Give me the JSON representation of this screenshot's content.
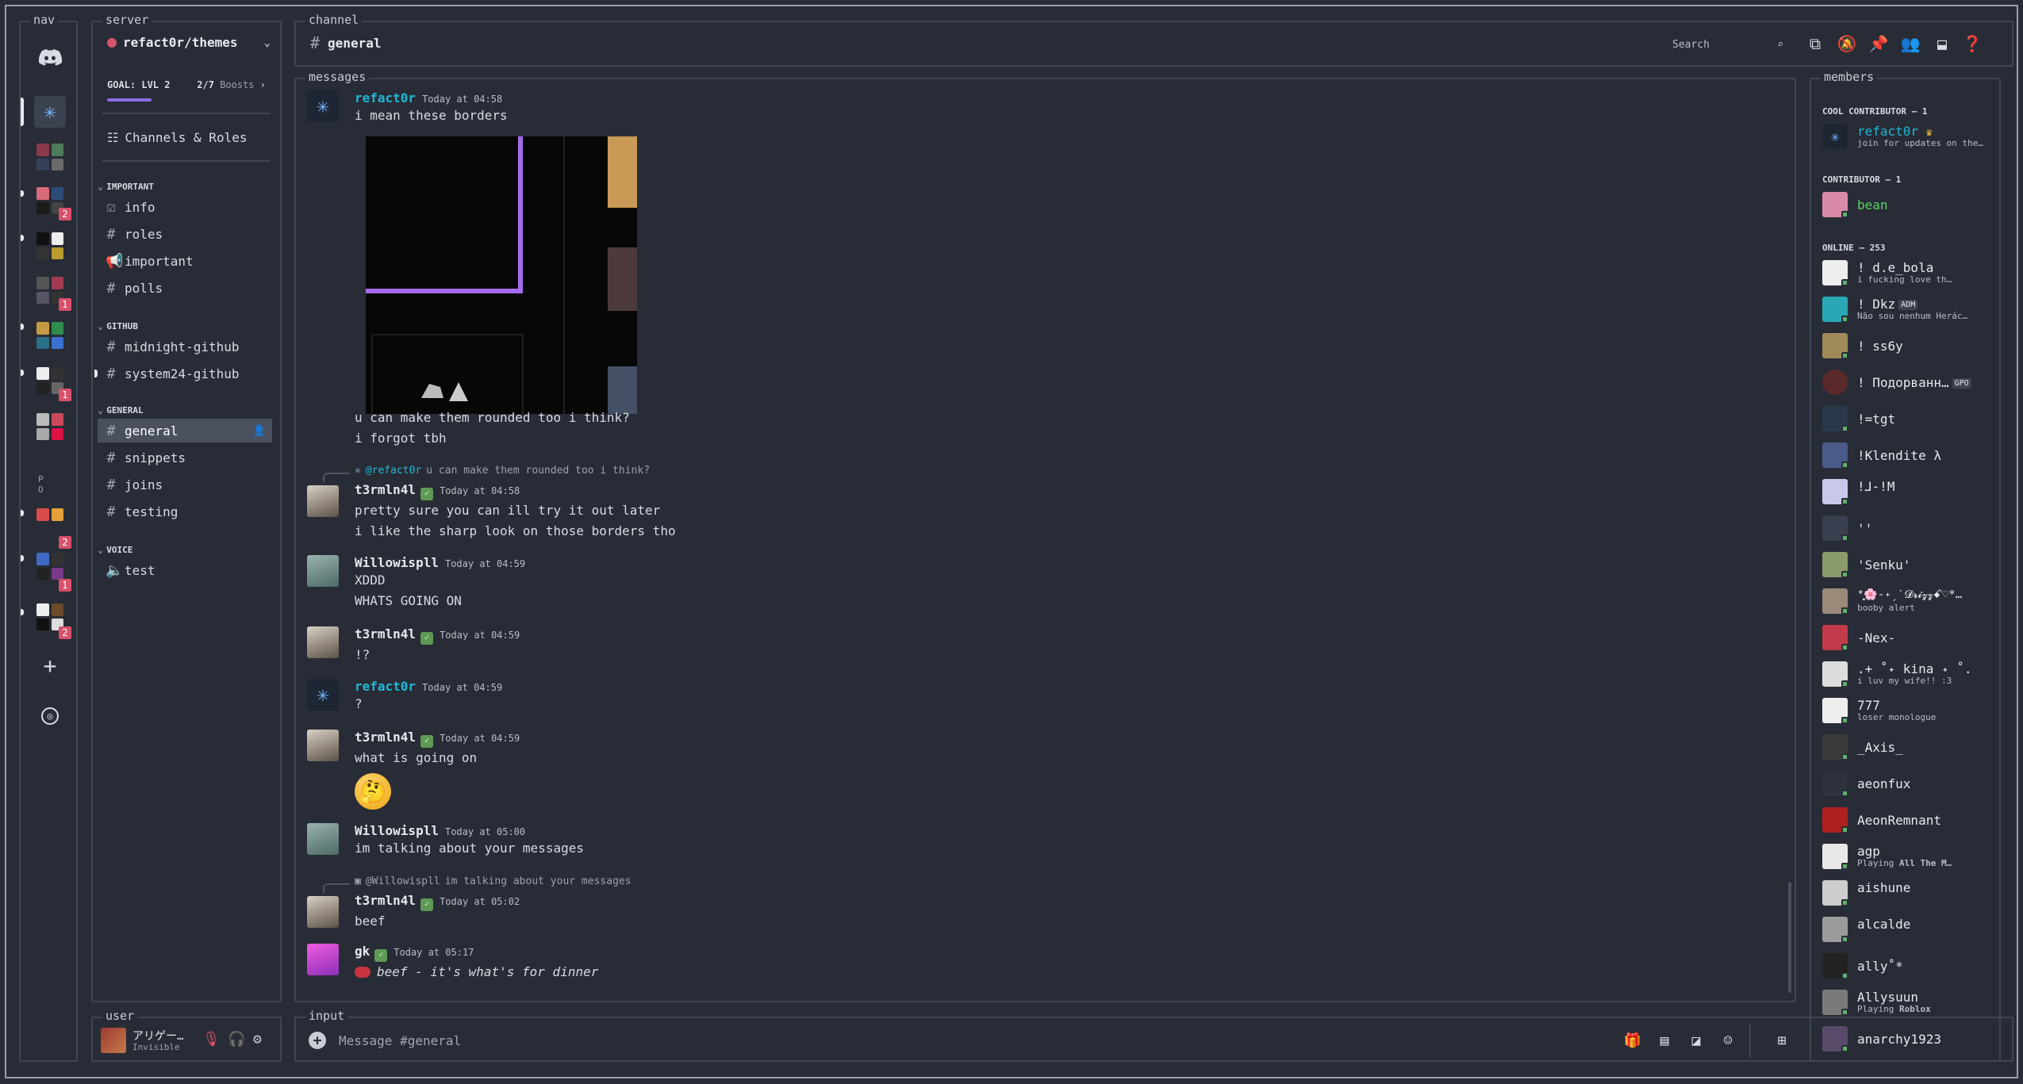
{
  "frames": {
    "nav": "nav",
    "server": "server",
    "channel": "channel",
    "messages": "messages",
    "members": "members",
    "user": "user",
    "input": "input"
  },
  "nav": {
    "badges": [
      "2",
      "1",
      "1",
      "2",
      "1",
      "2"
    ],
    "po_text": "P O"
  },
  "server": {
    "name": "refact0r/themes",
    "goal": "GOAL: LVL 2",
    "boosts_count": "2/7",
    "boosts_label": "Boosts",
    "channels_roles": "Channels & Roles",
    "categories": {
      "important": "IMPORTANT",
      "github": "GITHUB",
      "general": "GENERAL",
      "voice": "VOICE"
    },
    "channels": {
      "info": "info",
      "roles": "roles",
      "important": "important",
      "polls": "polls",
      "midnight_github": "midnight-github",
      "system24_github": "system24-github",
      "general": "general",
      "snippets": "snippets",
      "joins": "joins",
      "testing": "testing",
      "test": "test"
    }
  },
  "user": {
    "name": "アリゲー…",
    "status": "Invisible"
  },
  "channel": {
    "name": "general",
    "search_placeholder": "Search"
  },
  "messages": [
    {
      "author": "refact0r",
      "time": "Today at 04:58",
      "lines": [
        "i mean these borders"
      ]
    },
    {
      "lines": [
        "u can make them rounded too i think?",
        "i forgot tbh"
      ]
    },
    {
      "reply_to": "@refact0r",
      "reply_text": "u can make them rounded too i think?",
      "author": "t3rmln4l",
      "time": "Today at 04:58",
      "lines": [
        "pretty sure you can ill try it out later",
        "i like the sharp look on those borders tho"
      ]
    },
    {
      "author": "Willowispll",
      "time": "Today at 04:59",
      "lines": [
        "XDDD",
        "WHATS GOING ON"
      ]
    },
    {
      "author": "t3rmln4l",
      "time": "Today at 04:59",
      "lines": [
        "!?"
      ]
    },
    {
      "author": "refact0r",
      "time": "Today at 04:59",
      "lines": [
        "?"
      ]
    },
    {
      "author": "t3rmln4l",
      "time": "Today at 04:59",
      "lines": [
        "what is going on"
      ]
    },
    {
      "author": "Willowispll",
      "time": "Today at 05:00",
      "lines": [
        "im talking about your messages"
      ]
    },
    {
      "reply_to": "@Willowispll",
      "reply_text": "im talking about your messages",
      "author": "t3rmln4l",
      "time": "Today at 05:02",
      "lines": [
        "beef"
      ]
    },
    {
      "author": "gk",
      "time": "Today at 05:17",
      "lines": [
        "beef - it's what's for dinner"
      ]
    }
  ],
  "members": {
    "categories": [
      "COOL CONTRIBUTOR — 1",
      "CONTRIBUTOR — 1",
      "ONLINE — 253"
    ],
    "list": [
      {
        "name": "refact0r",
        "sub": "join for updates on the…"
      },
      {
        "name": "bean"
      },
      {
        "name": "! d.e_bola",
        "sub": "i fucking love th…"
      },
      {
        "name": "! Dkz",
        "tag": "ADM",
        "sub": "Não sou nenhum Herác…"
      },
      {
        "name": "! ss6y"
      },
      {
        "name": "! Подорванн…",
        "tag": "GPO"
      },
      {
        "name": "!=tgt"
      },
      {
        "name": "!Klendite λ"
      },
      {
        "name": "!⅃-!M"
      },
      {
        "name": "''"
      },
      {
        "name": "'Senku'"
      },
      {
        "name": "*̥͙🌸-˖ˏˋ𝓓𝓻𝓲𝔃𝔃ꗃ♡*…",
        "sub": "booby alert"
      },
      {
        "name": "-Nex-"
      },
      {
        "name": ".+ ˚˖ kina ˖ ˚.",
        "sub": "i luv my wife!! :3"
      },
      {
        "name": "777",
        "sub": "loser monologue"
      },
      {
        "name": "_Axis_"
      },
      {
        "name": "aeonfux"
      },
      {
        "name": "AeonRemnant"
      },
      {
        "name": "agp",
        "sub_prefix": "Playing",
        "sub_bold": "All The M…"
      },
      {
        "name": "aishune"
      },
      {
        "name": "alcalde"
      },
      {
        "name": "ally˚*"
      },
      {
        "name": "Allysuun",
        "sub_prefix": "Playing",
        "sub_bold": "Roblox"
      },
      {
        "name": "anarchy1923"
      }
    ]
  },
  "input": {
    "placeholder": "Message #general"
  },
  "colors": {
    "accent": "#1fb8d6",
    "boost_bar": "#8e6ce8",
    "badge": "#d9506b",
    "online": "#5fb06a"
  }
}
